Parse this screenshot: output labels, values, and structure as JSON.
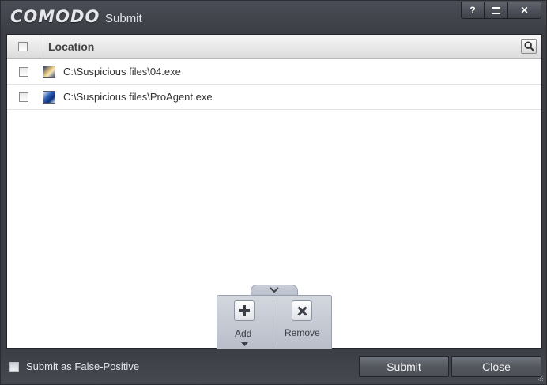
{
  "window": {
    "brand": "COMODO",
    "title": "Submit",
    "controls": [
      "?",
      "maximize",
      "close"
    ],
    "help_label": "?",
    "close_label": "✕"
  },
  "table": {
    "column_header": "Location",
    "rows": [
      {
        "path": "C:\\Suspicious files\\04.exe",
        "icon": "exe-app-icon",
        "checked": false
      },
      {
        "path": "C:\\Suspicious files\\ProAgent.exe",
        "icon": "exe-app-icon",
        "checked": false
      }
    ]
  },
  "toolbar": {
    "add_label": "Add",
    "remove_label": "Remove"
  },
  "footer": {
    "false_positive_label": "Submit as False-Positive",
    "false_positive_checked": false,
    "submit_label": "Submit",
    "close_label": "Close"
  },
  "colors": {
    "window_bg": "#3b3e45",
    "panel_bg": "#ffffff",
    "toolbar_bg": "#c7ccd5"
  }
}
